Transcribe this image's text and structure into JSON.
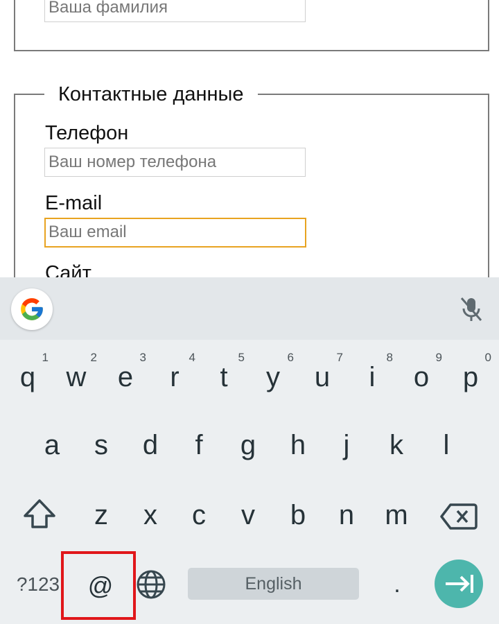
{
  "form": {
    "surname_placeholder": "Ваша фамилия",
    "contact_legend": "Контактные данные",
    "phone_label": "Телефон",
    "phone_placeholder": "Ваш номер телефона",
    "email_label": "E-mail",
    "email_placeholder": "Ваш email",
    "site_label": "Сайт"
  },
  "keyboard": {
    "row1": [
      {
        "key": "q",
        "hint": "1"
      },
      {
        "key": "w",
        "hint": "2"
      },
      {
        "key": "e",
        "hint": "3"
      },
      {
        "key": "r",
        "hint": "4"
      },
      {
        "key": "t",
        "hint": "5"
      },
      {
        "key": "y",
        "hint": "6"
      },
      {
        "key": "u",
        "hint": "7"
      },
      {
        "key": "i",
        "hint": "8"
      },
      {
        "key": "o",
        "hint": "9"
      },
      {
        "key": "p",
        "hint": "0"
      }
    ],
    "row2": [
      "a",
      "s",
      "d",
      "f",
      "g",
      "h",
      "j",
      "k",
      "l"
    ],
    "row3": [
      "z",
      "x",
      "c",
      "v",
      "b",
      "n",
      "m"
    ],
    "symbols_label": "?123",
    "at_label": "@",
    "space_label": "English",
    "period_label": ".",
    "icons": {
      "google": "google-g-icon",
      "mic": "mic-off-icon",
      "shift": "shift-icon",
      "backspace": "backspace-icon",
      "globe": "globe-icon",
      "enter": "next-arrow-icon"
    }
  },
  "colors": {
    "focus_border": "#e8a320",
    "highlight": "#e0161a",
    "enter_bg": "#4db6ac",
    "keyboard_bg": "#eceff1"
  }
}
